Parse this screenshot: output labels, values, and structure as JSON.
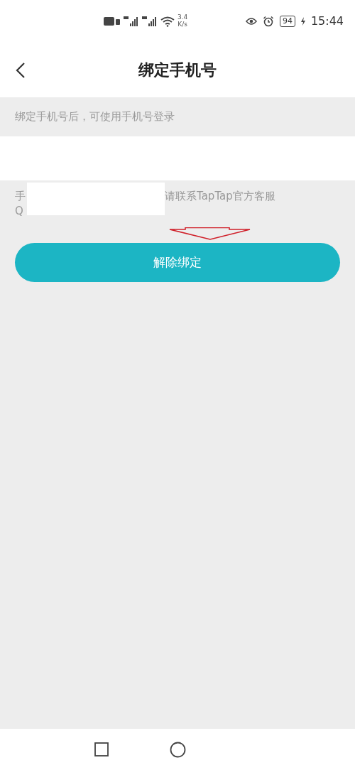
{
  "status_bar": {
    "speed_value": "3.4",
    "speed_unit": "K/s",
    "battery": "94",
    "time": "15:44"
  },
  "header": {
    "title": "绑定手机号"
  },
  "hint": "绑定手机号后，可使用手机号登录",
  "note": {
    "line_1_start": "手",
    "line_1_end": "请联系TapTap官方客服",
    "line_2_start": "Q"
  },
  "button": {
    "label": "解除绑定"
  }
}
